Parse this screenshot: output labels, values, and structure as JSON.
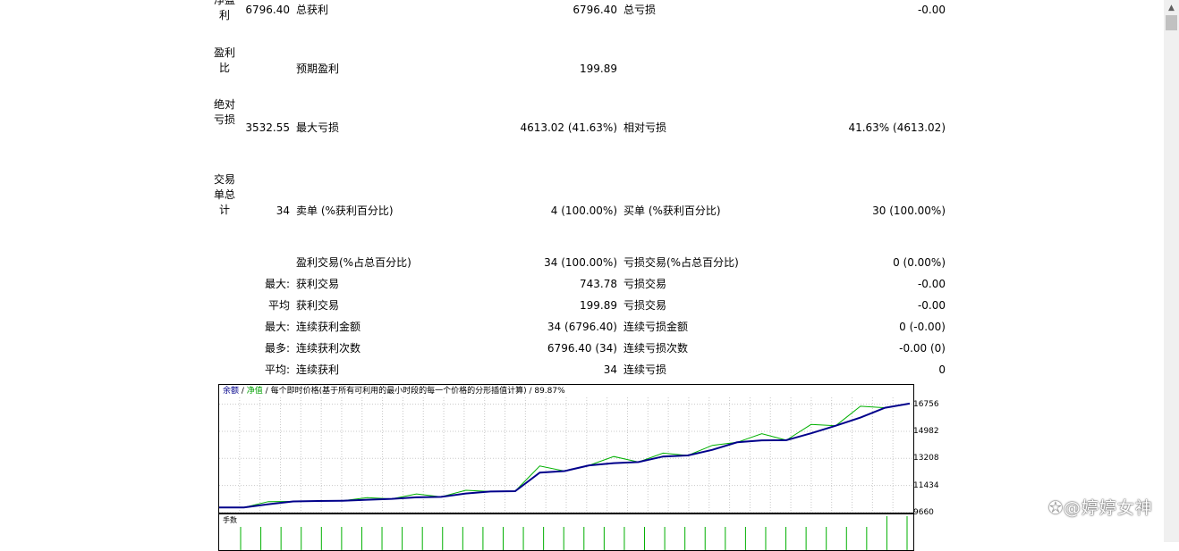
{
  "rows": {
    "net_profit": {
      "label": "净盈利",
      "value": "6796.40",
      "gross_profit_label": "总获利",
      "gross_profit_value": "6796.40",
      "gross_loss_label": "总亏损",
      "gross_loss_value": "-0.00"
    },
    "profit_factor": {
      "label": "盈利比",
      "expected_payoff_label": "预期盈利",
      "expected_payoff_value": "199.89"
    },
    "absolute_drawdown": {
      "label": "绝对亏损",
      "value": "3532.55",
      "max_drawdown_label": "最大亏损",
      "max_drawdown_value": "4613.02 (41.63%)",
      "relative_drawdown_label": "相对亏损",
      "relative_drawdown_value": "41.63% (4613.02)"
    },
    "total_trades": {
      "label": "交易单总计",
      "value": "34",
      "short_label": "卖单 (%获利百分比)",
      "short_value": "4 (100.00%)",
      "long_label": "买单 (%获利百分比)",
      "long_value": "30 (100.00%)"
    },
    "profit_trades": {
      "label": "盈利交易(%占总百分比)",
      "value": "34 (100.00%)",
      "loss_label": "亏损交易(%占总百分比)",
      "loss_value": "0 (0.00%)"
    },
    "largest": {
      "prefix": "最大:",
      "profit_label": "获利交易",
      "profit_value": "743.78",
      "loss_label": "亏损交易",
      "loss_value": "-0.00"
    },
    "average": {
      "prefix": "平均",
      "profit_label": "获利交易",
      "profit_value": "199.89",
      "loss_label": "亏损交易",
      "loss_value": "-0.00"
    },
    "max_consecutive": {
      "prefix": "最大:",
      "wins_label": "连续获利金额",
      "wins_value": "34 (6796.40)",
      "losses_label": "连续亏损金额",
      "losses_value": "0 (-0.00)"
    },
    "maximal_consecutive": {
      "prefix": "最多:",
      "profit_label": "连续获利次数",
      "profit_value": "6796.40 (34)",
      "loss_label": "连续亏损次数",
      "loss_value": "-0.00 (0)"
    },
    "average_consecutive": {
      "prefix": "平均:",
      "wins_label": "连续获利",
      "wins_value": "34",
      "losses_label": "连续亏损",
      "losses_value": "0"
    }
  },
  "chart_header": {
    "balance": "余额",
    "sep1": " / ",
    "equity": "净值",
    "sep2": " / ",
    "model": "每个即时价格(基于所有可利用的最小时段的每一个价格的分形插值计算)",
    "sep3": " / ",
    "quality": "89.87%"
  },
  "lots_title": "手数",
  "watermark": "@婷婷女神",
  "colors": {
    "balance_line": "#00008b",
    "equity_line": "#00b000",
    "grid": "#c8c8c8",
    "lots_bars": "#00b000",
    "header_balance": "#00008b",
    "header_equity": "#00a000"
  },
  "icons": {
    "scroll_up": "triangle-up-icon",
    "watermark_logo": "weibo-icon"
  },
  "chart_data": {
    "type": "line",
    "ylim": [
      9660,
      17200
    ],
    "yticks": [
      9660,
      11434,
      13208,
      14982,
      16756
    ],
    "grid": true,
    "series": [
      {
        "name": "余额",
        "values": [
          10000,
          10000,
          10210,
          10390,
          10420,
          10440,
          10500,
          10560,
          10660,
          10690,
          10910,
          11040,
          11060,
          12280,
          12380,
          12750,
          12900,
          12970,
          13330,
          13400,
          13770,
          14260,
          14390,
          14400,
          14850,
          15350,
          15880,
          16520,
          16796
        ]
      },
      {
        "name": "净值",
        "values": [
          10000,
          10000,
          10380,
          10390,
          10420,
          10440,
          10640,
          10560,
          10880,
          10690,
          11120,
          11040,
          11060,
          12710,
          12380,
          12750,
          13330,
          12970,
          13550,
          13400,
          14060,
          14260,
          14820,
          14400,
          15430,
          15350,
          16620,
          16520,
          16796
        ]
      }
    ],
    "lots_bars": 34
  }
}
